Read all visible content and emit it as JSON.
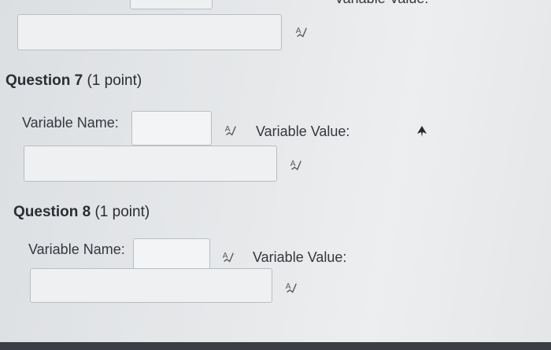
{
  "top": {
    "clipped_label": "Variable Value:"
  },
  "questions": [
    {
      "title": "Question 7",
      "points": "(1 point)",
      "name_label": "Variable Name:",
      "value_label": "Variable Value:",
      "name_value": "",
      "value_value": ""
    },
    {
      "title": "Question 8",
      "points": "(1 point)",
      "name_label": "Variable Name:",
      "value_label": "Variable Value:",
      "name_value": "",
      "value_value": ""
    }
  ],
  "icons": {
    "spellcheck": "spellcheck-icon",
    "cursor": "mouse-pointer-icon"
  },
  "colors": {
    "field_border": "#b9bec3",
    "field_bg": "#eef0f1",
    "text": "#2d3035"
  }
}
